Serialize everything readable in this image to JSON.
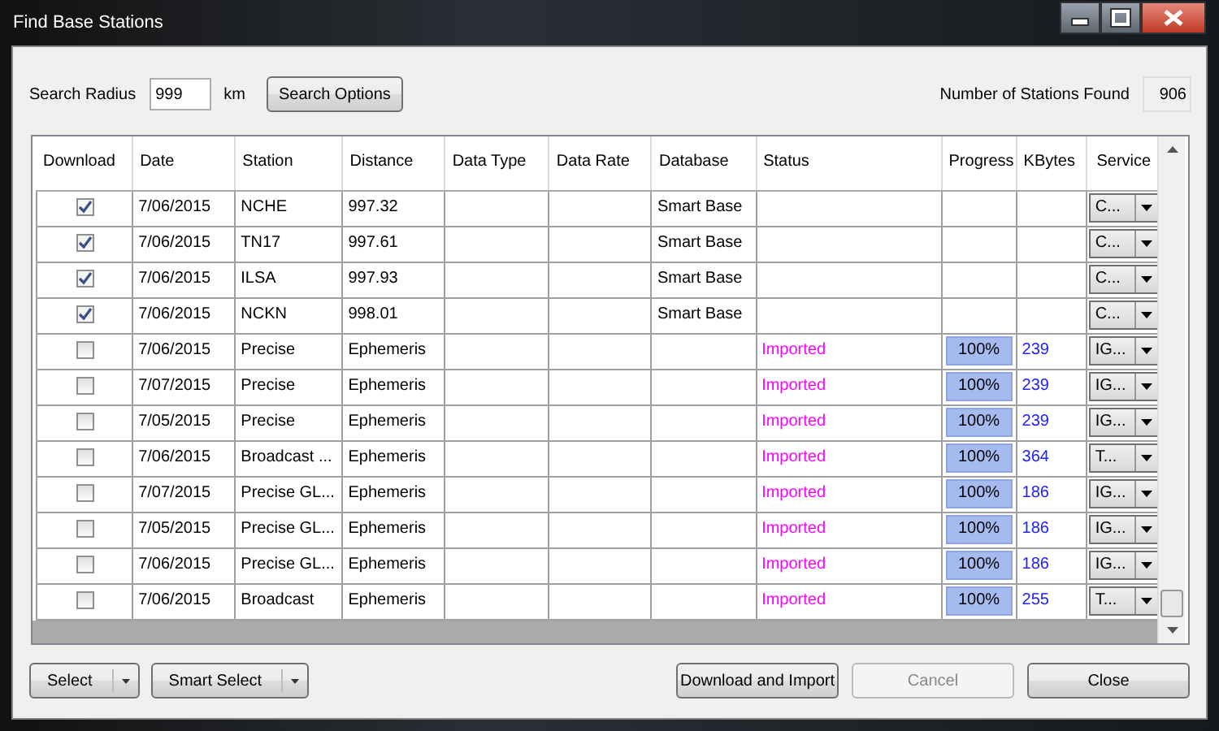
{
  "window": {
    "title": "Find Base Stations"
  },
  "search": {
    "label": "Search Radius",
    "value": "999",
    "unit": "km",
    "options_button": "Search Options"
  },
  "found": {
    "label": "Number of Stations Found",
    "value": "906"
  },
  "table": {
    "columns": [
      "Download",
      "Date",
      "Station",
      "Distance",
      "Data Type",
      "Data Rate",
      "Database",
      "Status",
      "Progress",
      "KBytes",
      "Service"
    ],
    "rows": [
      {
        "checked": true,
        "date": "7/06/2015",
        "station": "NCHE",
        "distance": "997.32",
        "database": "Smart Base",
        "service": "C..."
      },
      {
        "checked": true,
        "date": "7/06/2015",
        "station": "TN17",
        "distance": "997.61",
        "database": "Smart Base",
        "service": "C..."
      },
      {
        "checked": true,
        "date": "7/06/2015",
        "station": "ILSA",
        "distance": "997.93",
        "database": "Smart Base",
        "service": "C..."
      },
      {
        "checked": true,
        "date": "7/06/2015",
        "station": "NCKN",
        "distance": "998.01",
        "database": "Smart Base",
        "service": "C..."
      },
      {
        "checked": false,
        "date": "7/06/2015",
        "station": "Precise",
        "distance": "Ephemeris",
        "status": "Imported",
        "progress": "100%",
        "level": 1,
        "kbytes": "239",
        "service": "IG..."
      },
      {
        "checked": false,
        "date": "7/07/2015",
        "station": "Precise",
        "distance": "Ephemeris",
        "status": "Imported",
        "progress": "100%",
        "level": 1,
        "kbytes": "239",
        "service": "IG..."
      },
      {
        "checked": false,
        "date": "7/05/2015",
        "station": "Precise",
        "distance": "Ephemeris",
        "status": "Imported",
        "progress": "100%",
        "level": 1,
        "kbytes": "239",
        "service": "IG..."
      },
      {
        "checked": false,
        "date": "7/06/2015",
        "station": "Broadcast ...",
        "distance": "Ephemeris",
        "status": "Imported",
        "progress": "100%",
        "level": 1,
        "kbytes": "364",
        "service": "T..."
      },
      {
        "checked": false,
        "date": "7/07/2015",
        "station": "Precise GL...",
        "distance": "Ephemeris",
        "status": "Imported",
        "progress": "100%",
        "level": 1,
        "kbytes": "186",
        "service": "IG..."
      },
      {
        "checked": false,
        "date": "7/05/2015",
        "station": "Precise GL...",
        "distance": "Ephemeris",
        "status": "Imported",
        "progress": "100%",
        "level": 1,
        "kbytes": "186",
        "service": "IG..."
      },
      {
        "checked": false,
        "date": "7/06/2015",
        "station": "Precise GL...",
        "distance": "Ephemeris",
        "status": "Imported",
        "progress": "100%",
        "level": 1,
        "kbytes": "186",
        "service": "IG..."
      },
      {
        "checked": false,
        "date": "7/06/2015",
        "station": "Broadcast",
        "distance": "Ephemeris",
        "status": "Imported",
        "progress": "100%",
        "level": 1,
        "kbytes": "255",
        "service": "T..."
      }
    ]
  },
  "left_buttons": [
    "Select",
    "Smart Select"
  ],
  "right_buttons": [
    {
      "label": "Download and Import",
      "disabled": false
    },
    {
      "label": "Cancel",
      "disabled": true
    },
    {
      "label": "Close",
      "disabled": false
    }
  ]
}
